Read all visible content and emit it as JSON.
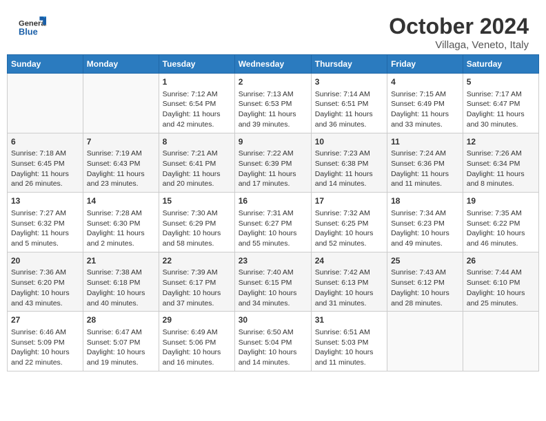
{
  "header": {
    "logo_general": "General",
    "logo_blue": "Blue",
    "month": "October 2024",
    "location": "Villaga, Veneto, Italy"
  },
  "days_of_week": [
    "Sunday",
    "Monday",
    "Tuesday",
    "Wednesday",
    "Thursday",
    "Friday",
    "Saturday"
  ],
  "weeks": [
    [
      {
        "day": "",
        "info": ""
      },
      {
        "day": "",
        "info": ""
      },
      {
        "day": "1",
        "sunrise": "Sunrise: 7:12 AM",
        "sunset": "Sunset: 6:54 PM",
        "daylight": "Daylight: 11 hours and 42 minutes."
      },
      {
        "day": "2",
        "sunrise": "Sunrise: 7:13 AM",
        "sunset": "Sunset: 6:53 PM",
        "daylight": "Daylight: 11 hours and 39 minutes."
      },
      {
        "day": "3",
        "sunrise": "Sunrise: 7:14 AM",
        "sunset": "Sunset: 6:51 PM",
        "daylight": "Daylight: 11 hours and 36 minutes."
      },
      {
        "day": "4",
        "sunrise": "Sunrise: 7:15 AM",
        "sunset": "Sunset: 6:49 PM",
        "daylight": "Daylight: 11 hours and 33 minutes."
      },
      {
        "day": "5",
        "sunrise": "Sunrise: 7:17 AM",
        "sunset": "Sunset: 6:47 PM",
        "daylight": "Daylight: 11 hours and 30 minutes."
      }
    ],
    [
      {
        "day": "6",
        "sunrise": "Sunrise: 7:18 AM",
        "sunset": "Sunset: 6:45 PM",
        "daylight": "Daylight: 11 hours and 26 minutes."
      },
      {
        "day": "7",
        "sunrise": "Sunrise: 7:19 AM",
        "sunset": "Sunset: 6:43 PM",
        "daylight": "Daylight: 11 hours and 23 minutes."
      },
      {
        "day": "8",
        "sunrise": "Sunrise: 7:21 AM",
        "sunset": "Sunset: 6:41 PM",
        "daylight": "Daylight: 11 hours and 20 minutes."
      },
      {
        "day": "9",
        "sunrise": "Sunrise: 7:22 AM",
        "sunset": "Sunset: 6:39 PM",
        "daylight": "Daylight: 11 hours and 17 minutes."
      },
      {
        "day": "10",
        "sunrise": "Sunrise: 7:23 AM",
        "sunset": "Sunset: 6:38 PM",
        "daylight": "Daylight: 11 hours and 14 minutes."
      },
      {
        "day": "11",
        "sunrise": "Sunrise: 7:24 AM",
        "sunset": "Sunset: 6:36 PM",
        "daylight": "Daylight: 11 hours and 11 minutes."
      },
      {
        "day": "12",
        "sunrise": "Sunrise: 7:26 AM",
        "sunset": "Sunset: 6:34 PM",
        "daylight": "Daylight: 11 hours and 8 minutes."
      }
    ],
    [
      {
        "day": "13",
        "sunrise": "Sunrise: 7:27 AM",
        "sunset": "Sunset: 6:32 PM",
        "daylight": "Daylight: 11 hours and 5 minutes."
      },
      {
        "day": "14",
        "sunrise": "Sunrise: 7:28 AM",
        "sunset": "Sunset: 6:30 PM",
        "daylight": "Daylight: 11 hours and 2 minutes."
      },
      {
        "day": "15",
        "sunrise": "Sunrise: 7:30 AM",
        "sunset": "Sunset: 6:29 PM",
        "daylight": "Daylight: 10 hours and 58 minutes."
      },
      {
        "day": "16",
        "sunrise": "Sunrise: 7:31 AM",
        "sunset": "Sunset: 6:27 PM",
        "daylight": "Daylight: 10 hours and 55 minutes."
      },
      {
        "day": "17",
        "sunrise": "Sunrise: 7:32 AM",
        "sunset": "Sunset: 6:25 PM",
        "daylight": "Daylight: 10 hours and 52 minutes."
      },
      {
        "day": "18",
        "sunrise": "Sunrise: 7:34 AM",
        "sunset": "Sunset: 6:23 PM",
        "daylight": "Daylight: 10 hours and 49 minutes."
      },
      {
        "day": "19",
        "sunrise": "Sunrise: 7:35 AM",
        "sunset": "Sunset: 6:22 PM",
        "daylight": "Daylight: 10 hours and 46 minutes."
      }
    ],
    [
      {
        "day": "20",
        "sunrise": "Sunrise: 7:36 AM",
        "sunset": "Sunset: 6:20 PM",
        "daylight": "Daylight: 10 hours and 43 minutes."
      },
      {
        "day": "21",
        "sunrise": "Sunrise: 7:38 AM",
        "sunset": "Sunset: 6:18 PM",
        "daylight": "Daylight: 10 hours and 40 minutes."
      },
      {
        "day": "22",
        "sunrise": "Sunrise: 7:39 AM",
        "sunset": "Sunset: 6:17 PM",
        "daylight": "Daylight: 10 hours and 37 minutes."
      },
      {
        "day": "23",
        "sunrise": "Sunrise: 7:40 AM",
        "sunset": "Sunset: 6:15 PM",
        "daylight": "Daylight: 10 hours and 34 minutes."
      },
      {
        "day": "24",
        "sunrise": "Sunrise: 7:42 AM",
        "sunset": "Sunset: 6:13 PM",
        "daylight": "Daylight: 10 hours and 31 minutes."
      },
      {
        "day": "25",
        "sunrise": "Sunrise: 7:43 AM",
        "sunset": "Sunset: 6:12 PM",
        "daylight": "Daylight: 10 hours and 28 minutes."
      },
      {
        "day": "26",
        "sunrise": "Sunrise: 7:44 AM",
        "sunset": "Sunset: 6:10 PM",
        "daylight": "Daylight: 10 hours and 25 minutes."
      }
    ],
    [
      {
        "day": "27",
        "sunrise": "Sunrise: 6:46 AM",
        "sunset": "Sunset: 5:09 PM",
        "daylight": "Daylight: 10 hours and 22 minutes."
      },
      {
        "day": "28",
        "sunrise": "Sunrise: 6:47 AM",
        "sunset": "Sunset: 5:07 PM",
        "daylight": "Daylight: 10 hours and 19 minutes."
      },
      {
        "day": "29",
        "sunrise": "Sunrise: 6:49 AM",
        "sunset": "Sunset: 5:06 PM",
        "daylight": "Daylight: 10 hours and 16 minutes."
      },
      {
        "day": "30",
        "sunrise": "Sunrise: 6:50 AM",
        "sunset": "Sunset: 5:04 PM",
        "daylight": "Daylight: 10 hours and 14 minutes."
      },
      {
        "day": "31",
        "sunrise": "Sunrise: 6:51 AM",
        "sunset": "Sunset: 5:03 PM",
        "daylight": "Daylight: 10 hours and 11 minutes."
      },
      {
        "day": "",
        "info": ""
      },
      {
        "day": "",
        "info": ""
      }
    ]
  ]
}
